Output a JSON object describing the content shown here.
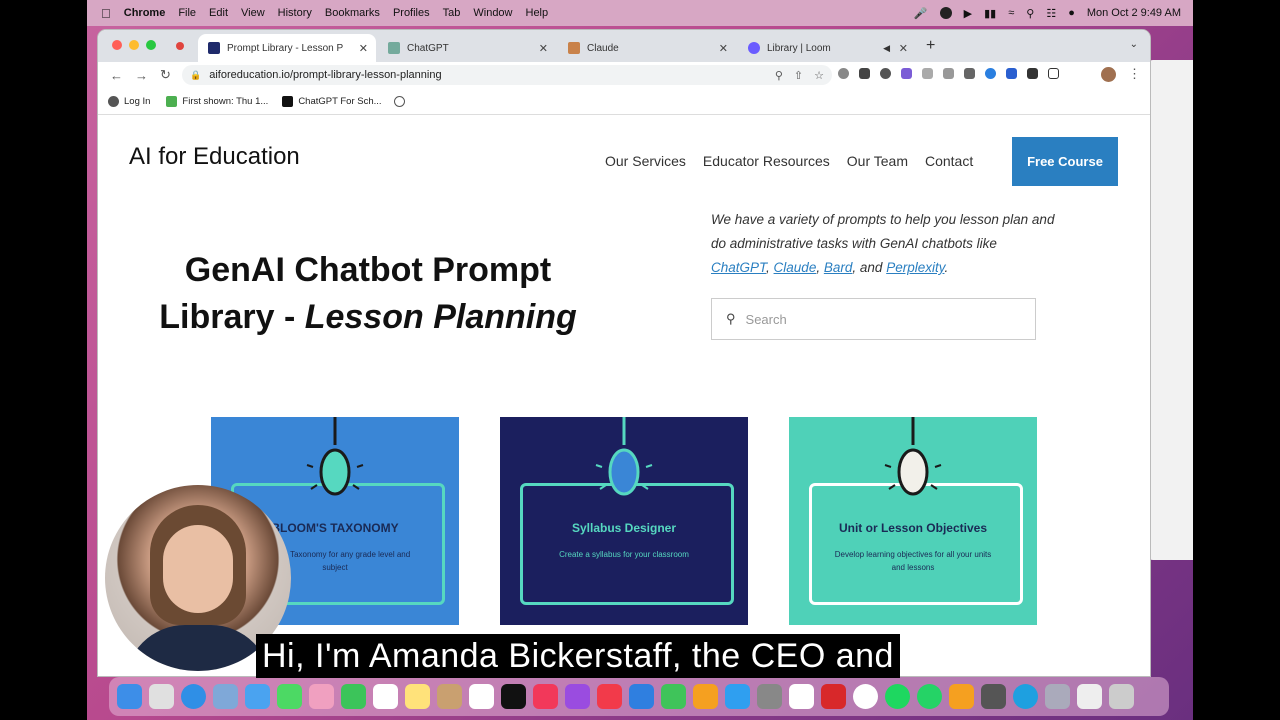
{
  "menubar": {
    "app_name": "Chrome",
    "items": [
      "File",
      "Edit",
      "View",
      "History",
      "Bookmarks",
      "Profiles",
      "Tab",
      "Window",
      "Help"
    ],
    "clock": "Mon Oct 2  9:49 AM"
  },
  "tabs": [
    {
      "title": "Prompt Library - Lesson P",
      "color": "#1f2a6b"
    },
    {
      "title": "ChatGPT",
      "color": "#74aa9c"
    },
    {
      "title": "Claude",
      "color": "#c9824a"
    },
    {
      "title": "Library | Loom",
      "color": "#6a5cff"
    }
  ],
  "address_bar": {
    "url": "aiforeducation.io/prompt-library-lesson-planning"
  },
  "bookmarks": [
    "Log In",
    "First shown: Thu 1...",
    "ChatGPT For Sch..."
  ],
  "site": {
    "logo": "AI for Education",
    "nav": [
      "Our Services",
      "Educator Resources",
      "Our Team",
      "Contact"
    ],
    "cta": "Free Course",
    "headline_plain": "GenAI Chatbot Prompt Library - ",
    "headline_italic": "Lesson Planning",
    "intro_text": "We have a variety of prompts to help you lesson plan and do administrative tasks with GenAI chatbots like",
    "intro_links": [
      "ChatGPT",
      "Claude",
      "Bard",
      "Perplexity"
    ],
    "intro_and": "and",
    "search_placeholder": "Search",
    "cards": [
      {
        "title": "BLOOM'S TAXONOMY",
        "desc": "Bloom's Taxonomy for any grade level and subject",
        "bg": "#3a86d6",
        "text_color": "#1a2a55",
        "bulb": "#56d8c0"
      },
      {
        "title": "Syllabus Designer",
        "desc": "Create a syllabus for your classroom",
        "bg": "#1b1f5e",
        "text_color": "#56d8c0",
        "bulb": "#3a86d6"
      },
      {
        "title": "Unit or Lesson Objectives",
        "desc": "Develop learning objectives for all your units and lessons",
        "bg": "#4fd1b8",
        "text_color": "#1a2a55",
        "bulb": "#f2f0ea"
      }
    ]
  },
  "caption": "Hi, I'm Amanda Bickerstaff, the CEO and"
}
